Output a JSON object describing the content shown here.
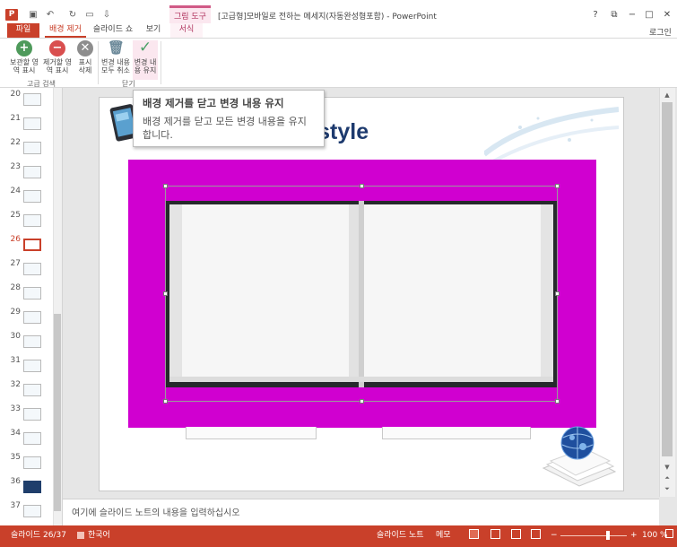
{
  "titlebar": {
    "app_icon": "P",
    "quick_access": [
      {
        "icon": "save-icon",
        "glyph": "▣"
      },
      {
        "icon": "undo-icon",
        "glyph": "↶"
      },
      {
        "icon": "redo-icon",
        "glyph": "↻"
      },
      {
        "icon": "start-slideshow-icon",
        "glyph": "▭"
      },
      {
        "icon": "customize-icon",
        "glyph": "⇩"
      }
    ],
    "contextual_group": "그림 도구",
    "window_title": "[고급형]모바일로 전하는 메세지(자동완성형포함) - PowerPoint",
    "buttons": {
      "help": "?",
      "restore": "⧉",
      "minimize": "−",
      "maximize": "□",
      "close": "✕"
    }
  },
  "tabs": {
    "file": "파일",
    "background_removal": "배경 제거",
    "slideshow": "슬라이드 쇼",
    "view": "보기",
    "format": "서식"
  },
  "login": "로그인",
  "ribbon": {
    "keep": {
      "label": "보관할 영역 표시",
      "glyph": "+"
    },
    "remove": {
      "label": "제거할 영역 표시",
      "glyph": "−"
    },
    "delete_mark": {
      "label": "표시 삭제",
      "glyph": "✕"
    },
    "discard": {
      "label": "변경 내용 모두 취소",
      "glyph": "🗑"
    },
    "apply": {
      "label": "변경 내용 유지",
      "glyph": "✓"
    },
    "group_refine": "고급 검색",
    "group_close": "닫기"
  },
  "tooltip": {
    "title": "배경 제거를 닫고 변경 내용 유지",
    "description": "배경 제거를 닫고 모든 변경 내용을 유지합니다."
  },
  "thumbnails": {
    "numbers": [
      "20",
      "21",
      "22",
      "23",
      "24",
      "25",
      "26",
      "27",
      "28",
      "29",
      "30",
      "31",
      "32",
      "33",
      "34",
      "35",
      "36",
      "37"
    ],
    "selected": "26"
  },
  "slide": {
    "title_fragment": "tle style"
  },
  "notes": {
    "placeholder": "여기에 슬라이드 노트의 내용을 입력하십시오"
  },
  "status": {
    "slide_indicator": "슬라이드 26/37",
    "language": "한국어",
    "notes_btn": "슬라이드 노트",
    "comments_btn": "메모",
    "zoom_minus": "−",
    "zoom_plus": "+",
    "zoom": "100 %"
  },
  "colors": {
    "accent": "#c9402a",
    "removal_magenta": "#d000d0",
    "slide_title": "#1d3a6e"
  }
}
